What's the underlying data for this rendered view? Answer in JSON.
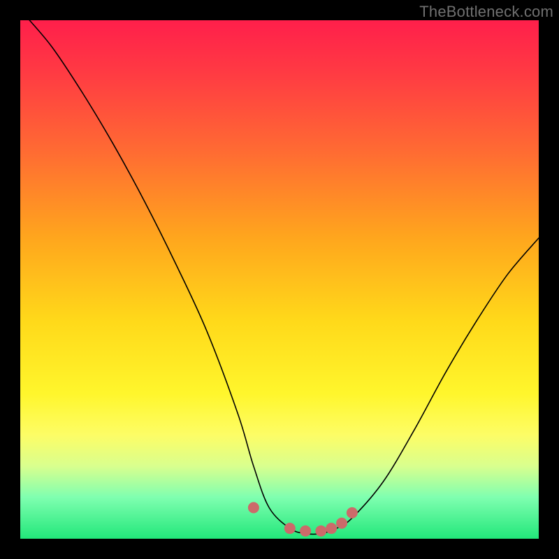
{
  "watermark": "TheBottleneck.com",
  "chart_data": {
    "type": "line",
    "title": "",
    "xlabel": "",
    "ylabel": "",
    "xlim": [
      0,
      100
    ],
    "ylim": [
      0,
      100
    ],
    "series": [
      {
        "name": "bottleneck-curve",
        "x": [
          0,
          6,
          12,
          18,
          24,
          30,
          36,
          42,
          45,
          48,
          52,
          55,
          58,
          61,
          64,
          70,
          76,
          82,
          88,
          94,
          100
        ],
        "values": [
          102,
          95,
          86,
          76,
          65,
          53,
          40,
          24,
          14,
          6,
          2,
          1,
          1,
          2,
          4,
          11,
          21,
          32,
          42,
          51,
          58
        ]
      }
    ],
    "markers": {
      "name": "bottom-dots",
      "color": "#cc6a6a",
      "radius_px": 8,
      "points_xy": [
        [
          45,
          6
        ],
        [
          52,
          2
        ],
        [
          55,
          1.5
        ],
        [
          58,
          1.5
        ],
        [
          60,
          2
        ],
        [
          62,
          3
        ],
        [
          64,
          5
        ]
      ]
    },
    "background_gradient": {
      "top": "#ff1f4b",
      "bottom": "#22e77a"
    }
  }
}
